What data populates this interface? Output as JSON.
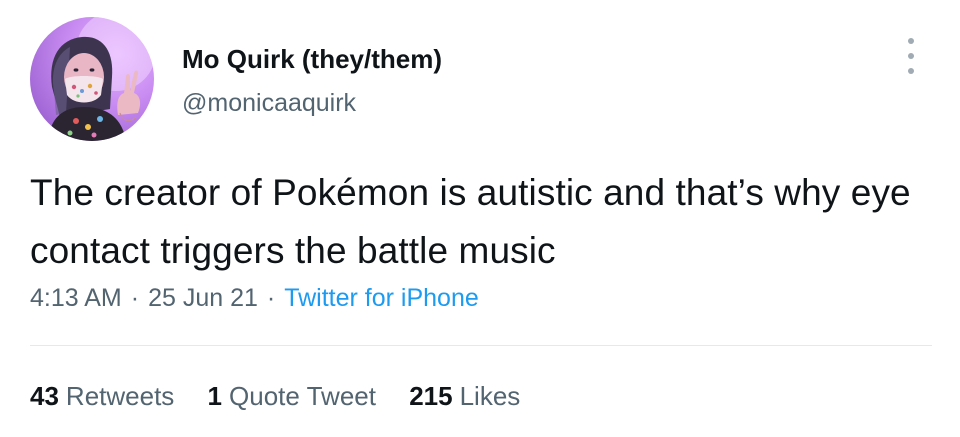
{
  "user": {
    "display_name": "Mo Quirk (they/them)",
    "handle": "@monicaaquirk",
    "avatar_icon": "profile-photo"
  },
  "tweet": {
    "text": "The creator of Pokémon is autistic and that’s why eye contact triggers the battle music"
  },
  "meta": {
    "time": "4:13 AM",
    "separator": "·",
    "date": "25 Jun 21",
    "source": "Twitter for iPhone"
  },
  "stats": {
    "retweets_count": "43",
    "retweets_label": "Retweets",
    "quotes_count": "1",
    "quotes_label": "Quote Tweet",
    "likes_count": "215",
    "likes_label": "Likes"
  },
  "colors": {
    "text_primary": "#0f1419",
    "text_secondary": "#536471",
    "link": "#1d9bf0",
    "divider": "#e6e9eb"
  },
  "icons": {
    "more": "more-options-icon"
  }
}
